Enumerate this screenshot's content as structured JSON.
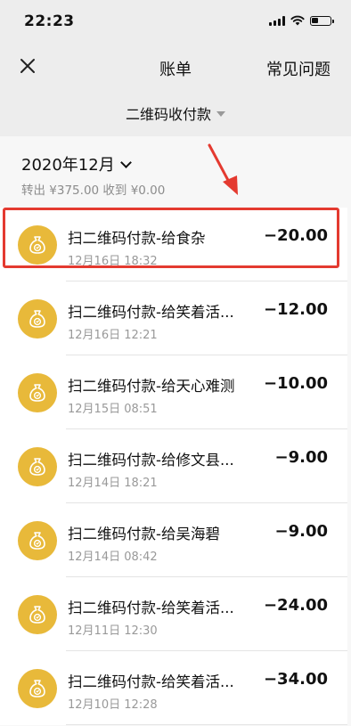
{
  "status": {
    "time": "22:23"
  },
  "nav": {
    "title": "账单",
    "faq": "常见问题"
  },
  "filter": {
    "label": "二维码收付款"
  },
  "summary_section": {
    "month": "2020年12月",
    "totals": "转出 ¥375.00 收到 ¥0.00"
  },
  "transactions": [
    {
      "title": "扫二维码付款-给食杂",
      "date": "12月16日 18:32",
      "amount": "−20.00"
    },
    {
      "title": "扫二维码付款-给笑着活...",
      "date": "12月16日 12:21",
      "amount": "−12.00"
    },
    {
      "title": "扫二维码付款-给天心难测",
      "date": "12月15日 08:51",
      "amount": "−10.00"
    },
    {
      "title": "扫二维码付款-给修文县...",
      "date": "12月14日 18:21",
      "amount": "−9.00"
    },
    {
      "title": "扫二维码付款-给吴海碧",
      "date": "12月14日 08:42",
      "amount": "−9.00"
    },
    {
      "title": "扫二维码付款-给笑着活...",
      "date": "12月11日 12:30",
      "amount": "−24.00"
    },
    {
      "title": "扫二维码付款-给笑着活...",
      "date": "12月10日 12:28",
      "amount": "−34.00"
    }
  ],
  "colors": {
    "icon_bg": "#e8b93a",
    "highlight": "#e43a30",
    "background": "#ededed"
  },
  "icons": [
    "close-icon",
    "money-bag-icon",
    "signal-icon",
    "wifi-icon",
    "battery-icon"
  ]
}
